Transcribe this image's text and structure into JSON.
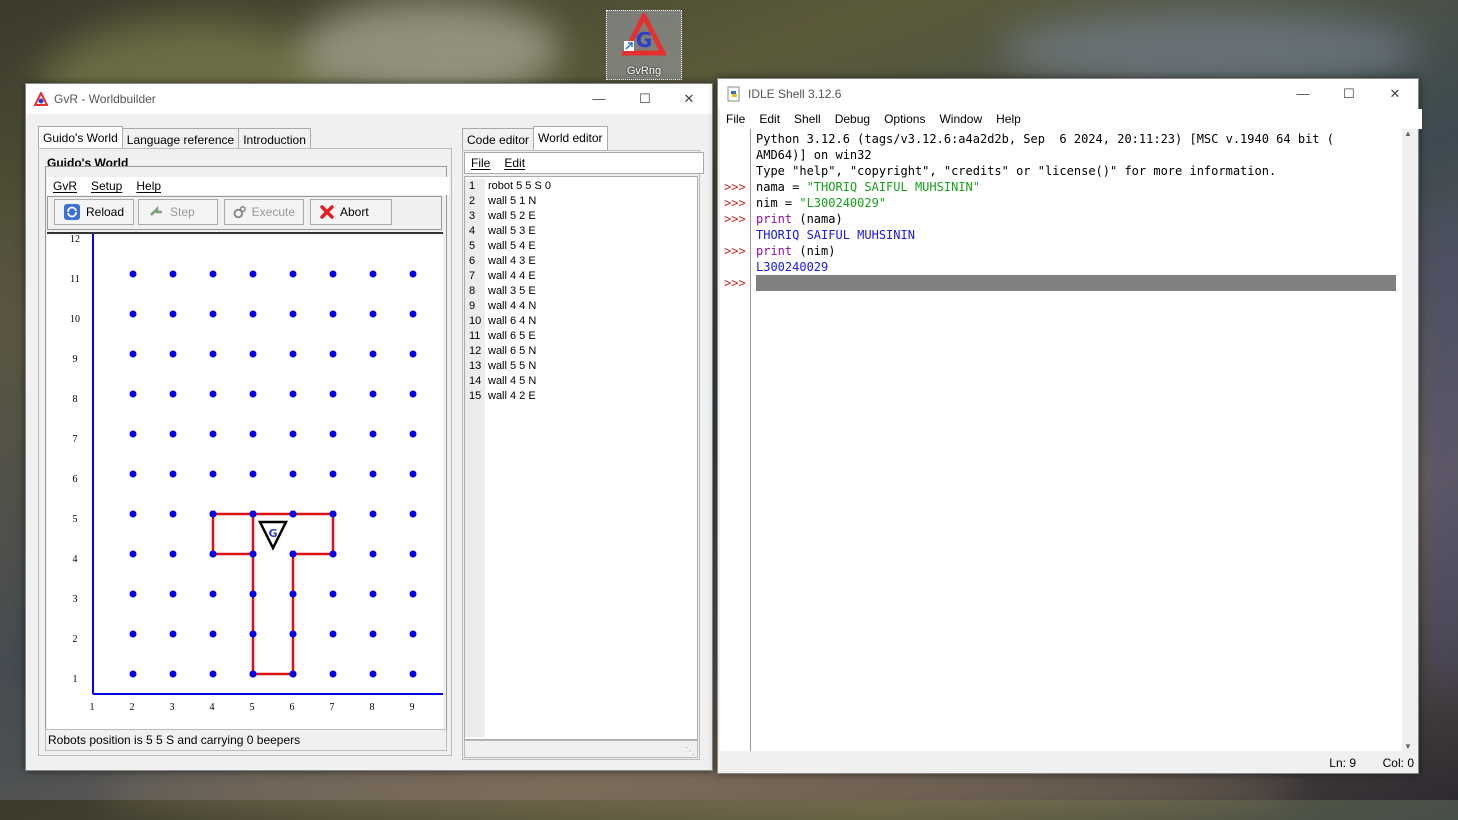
{
  "desktop": {
    "icon_label": "GvRng"
  },
  "gvr_window": {
    "title": "GvR - Worldbuilder",
    "left_tabs": [
      "Guido's World",
      "Language reference",
      "Introduction"
    ],
    "right_tabs": [
      "Code editor",
      "World editor"
    ],
    "group_title": "Guido's World",
    "menu": [
      "GvR",
      "Setup",
      "Help"
    ],
    "buttons": {
      "reload": "Reload",
      "step": "Step",
      "execute": "Execute",
      "abort": "Abort"
    },
    "status": "Robots position is 5 5 S and carrying 0 beepers",
    "editor_menu": [
      "File",
      "Edit"
    ],
    "editor_line_numbers": [
      "1",
      "2",
      "3",
      "4",
      "5",
      "6",
      "7",
      "8",
      "9",
      "10",
      "11",
      "12",
      "13",
      "14",
      "15"
    ],
    "editor_lines": [
      "robot 5 5 S 0",
      "wall 5 1 N",
      "wall 5 2 E",
      "wall 5 3 E",
      "wall 5 4 E",
      "wall 4 3 E",
      "wall 4 4 E",
      "wall 3 5 E",
      "wall 4 4 N",
      "wall 6 4 N",
      "wall 6 5 E",
      "wall 6 5 N",
      "wall 5 5 N",
      "wall 4 5 N",
      "wall 4 2 E"
    ],
    "world": {
      "x_labels": [
        "1",
        "2",
        "3",
        "4",
        "5",
        "6",
        "7",
        "8",
        "9"
      ],
      "y_labels": [
        "12",
        "11",
        "10",
        "9",
        "8",
        "7",
        "6",
        "5",
        "4",
        "3",
        "2",
        "1"
      ],
      "grid_color": "#0000ee",
      "wall_color": "#dd1111",
      "robot_symbol": "G"
    }
  },
  "idle_window": {
    "title": "IDLE Shell 3.12.6",
    "menu": [
      "File",
      "Edit",
      "Shell",
      "Debug",
      "Options",
      "Window",
      "Help"
    ],
    "banner1": "Python 3.12.6 (tags/v3.12.6:a4a2d2b, Sep  6 2024, 20:11:23) [MSC v.1940 64 bit (",
    "banner2": "AMD64)] on win32",
    "banner3": "Type \"help\", \"copyright\", \"credits\" or \"license()\" for more information.",
    "prompt": ">>>",
    "line_nama_prefix": "nama = ",
    "line_nama_value": "\"THORIQ SAIFUL MUHSININ\"",
    "line_nim_prefix": "nim = ",
    "line_nim_value": "\"L300240029\"",
    "print_kw": "print",
    "print_nama_arg": " (nama)",
    "print_nim_arg": " (nim)",
    "output_nama": "THORIQ SAIFUL MUHSININ",
    "output_nim": "L300240029",
    "status_ln": "Ln: 9",
    "status_col": "Col: 0"
  }
}
